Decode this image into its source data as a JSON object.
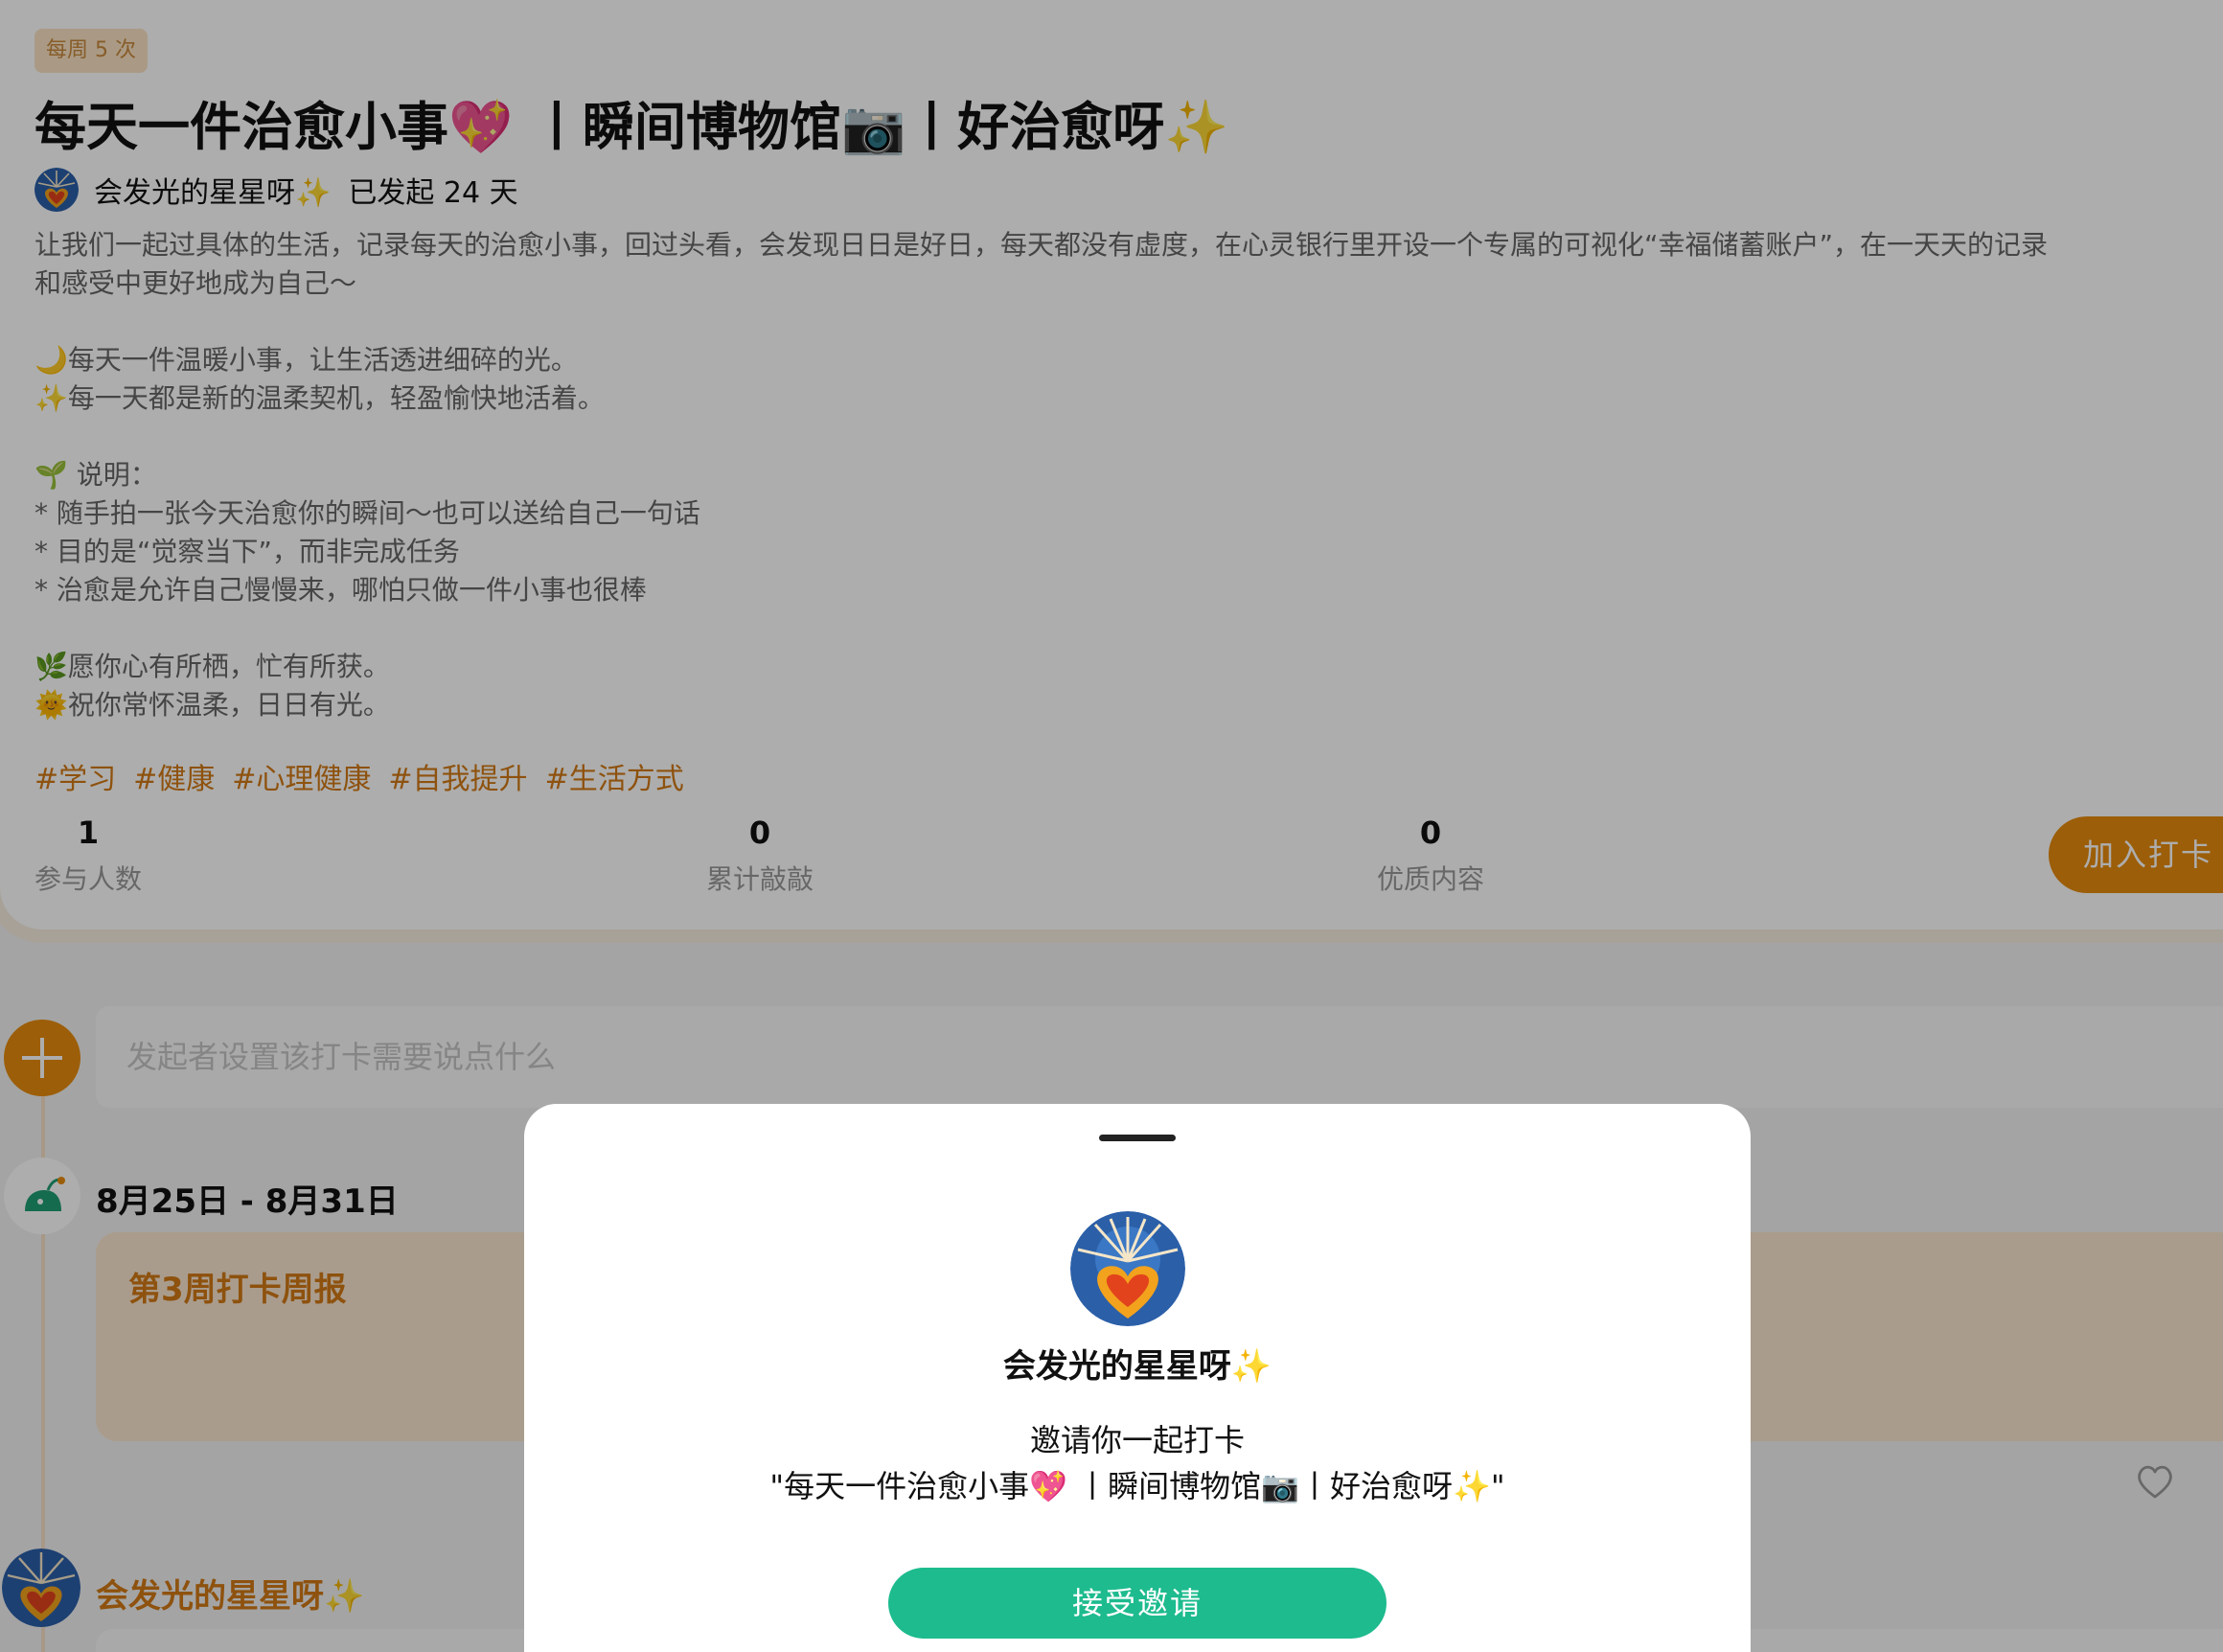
{
  "challenge": {
    "frequency_badge": "每周 5 次",
    "title": "每天一件治愈小事💖 丨瞬间博物馆📷丨好治愈呀✨",
    "owner_name": "会发光的星星呀✨",
    "days_label": "已发起 24 天",
    "description_lines": [
      "让我们一起过具体的生活，记录每天的治愈小事，回过头看，会发现日日是好日，每天都没有虚度，在心灵银行里开设一个专属的可视化“幸福储蓄账户”，在一天天的记录",
      "和感受中更好地成为自己～",
      "",
      "🌙每天一件温暖小事，让生活透进细碎的光。",
      "✨每一天都是新的温柔契机，轻盈愉快地活着。",
      "",
      "🌱 说明：",
      "* 随手拍一张今天治愈你的瞬间～也可以送给自己一句话",
      "* 目的是“觉察当下”，而非完成任务",
      "* 治愈是允许自己慢慢来，哪怕只做一件小事也很棒",
      "",
      "🌿愿你心有所栖，忙有所获。",
      "🌞祝你常怀温柔，日日有光。"
    ],
    "tags": [
      "#学习",
      "#健康",
      "#心理健康",
      "#自我提升",
      "#生活方式"
    ],
    "stats": [
      {
        "value": "1",
        "label": "参与人数"
      },
      {
        "value": "0",
        "label": "累计敲敲"
      },
      {
        "value": "0",
        "label": "优质内容"
      }
    ],
    "join_label": "加入打卡"
  },
  "feed": {
    "post_placeholder": "发起者设置该打卡需要说点什么",
    "week_range": "8月25日 - 8月31日",
    "report_title": "第3周打卡周报",
    "author_name": "会发光的星星呀✨"
  },
  "sheet": {
    "name": "会发光的星星呀✨",
    "invite_text": "邀请你一起打卡",
    "challenge_quote": "\"每天一件治愈小事💖 丨瞬间博物馆📷丨好治愈呀✨\"",
    "accept_label": "接受邀请"
  },
  "colors": {
    "accent_orange": "#e68b0d",
    "tag_orange": "#d17a16",
    "accept_green": "#1dbb8e"
  }
}
